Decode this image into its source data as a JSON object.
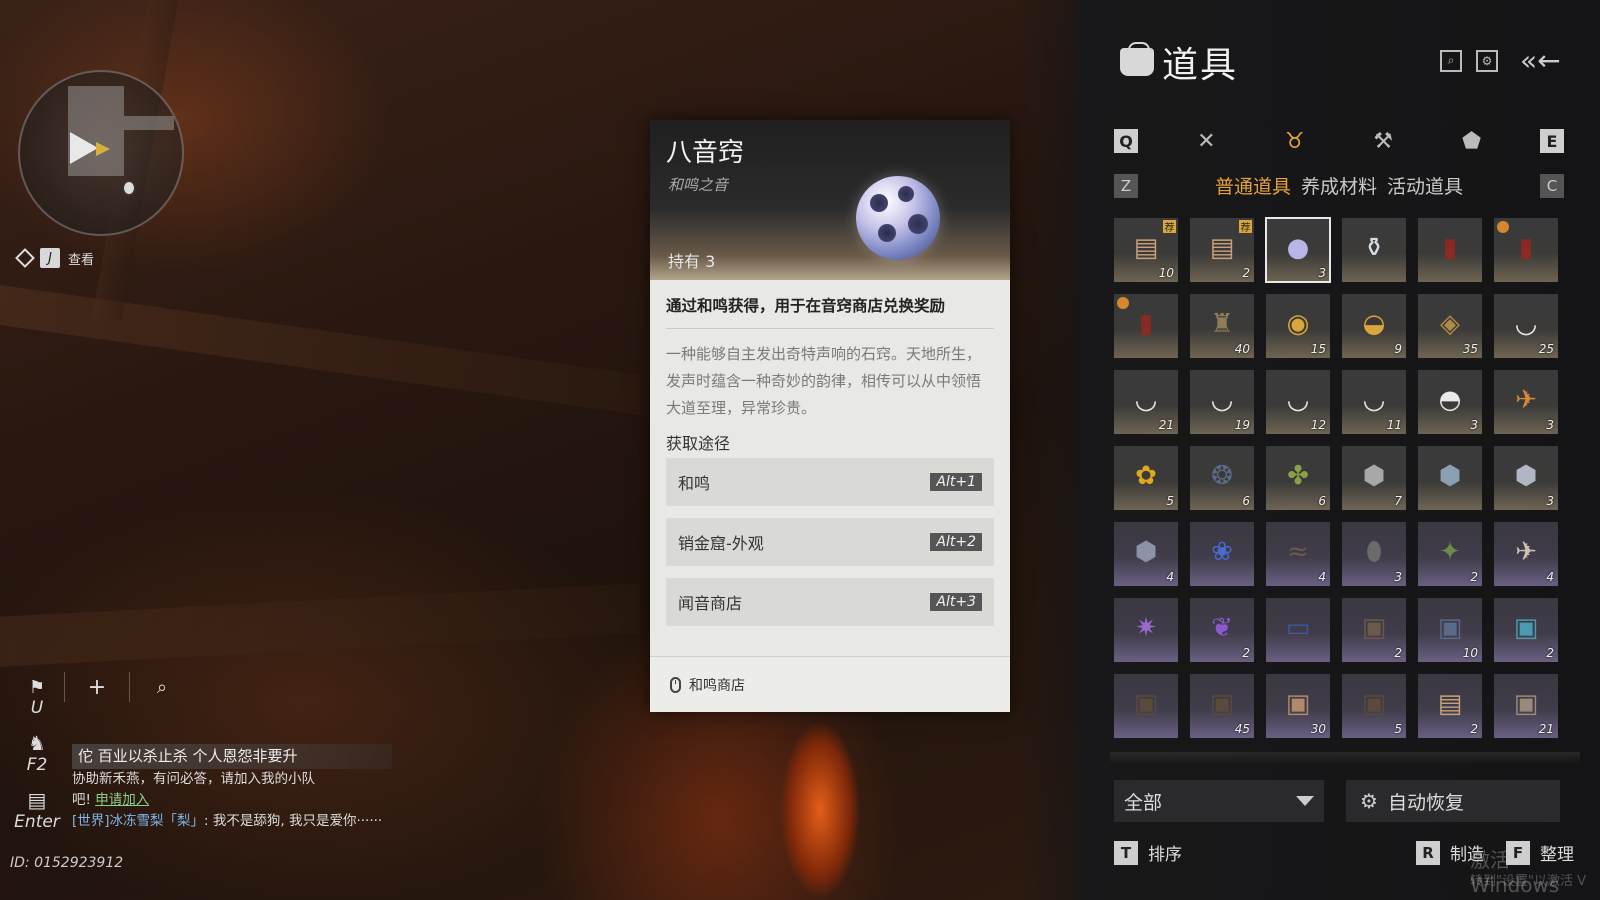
{
  "minimap": {
    "view_key": "J",
    "view_label": "查看"
  },
  "tools": {
    "flag_key": "U",
    "social_key": "F2",
    "chat_key": "Enter"
  },
  "chat": {
    "banner": "佗 百业以杀止杀 个人恩怨非要升",
    "line1": "协助新禾燕，有问必答，请加入我的小队",
    "line2_prefix": "吧! ",
    "line2_link": "申请加入",
    "line3_channel": "[世界]",
    "line3_name": "冰冻雪梨「梨」",
    "line3_text": ": 我不是舔狗, 我只是爱你······"
  },
  "user_id": "ID: 0152923912",
  "tooltip": {
    "title": "八音窍",
    "subtitle": "和鸣之音",
    "owned": "持有 3",
    "lead": "通过和鸣获得，用于在音窍商店兑换奖励",
    "desc": "一种能够自主发出奇特声响的石窍。天地所生，发声时蕴含一种奇妙的韵律，相传可以从中领悟大道至理，异常珍贵。",
    "section": "获取途径",
    "sources": [
      {
        "label": "和鸣",
        "key": "Alt+1"
      },
      {
        "label": "销金窟-外观",
        "key": "Alt+2"
      },
      {
        "label": "闻音商店",
        "key": "Alt+3"
      }
    ],
    "footer": "和鸣商店"
  },
  "inventory": {
    "title": "道具",
    "cat_left_key": "Q",
    "cat_right_key": "E",
    "sub_left_key": "Z",
    "sub_right_key": "C",
    "sub_tabs": [
      "普通道具",
      "养成材料",
      "活动道具"
    ],
    "active_sub_tab": 0,
    "tag_glyph": "荐",
    "items": [
      {
        "count": "10",
        "icon": "crate-icon",
        "glyph": "▤",
        "color": "#c8a27a",
        "tag": true
      },
      {
        "count": "2",
        "icon": "crate-icon",
        "glyph": "▤",
        "color": "#c8a27a",
        "tag": true
      },
      {
        "count": "3",
        "icon": "orb-icon",
        "glyph": "●",
        "color": "#b7b6e6",
        "sel": true
      },
      {
        "count": "",
        "icon": "vase-icon",
        "glyph": "⚱",
        "color": "#d8dce6"
      },
      {
        "count": "",
        "icon": "red-book-icon",
        "glyph": "▮",
        "color": "#8a2a22"
      },
      {
        "count": "",
        "icon": "red-book-icon",
        "glyph": "▮",
        "color": "#8a2a22",
        "clock": true
      },
      {
        "count": "",
        "icon": "red-book-icon",
        "glyph": "▮",
        "color": "#8a2a22",
        "clock": true
      },
      {
        "count": "40",
        "icon": "bronze-vessel-icon",
        "glyph": "♜",
        "color": "#8f7c5a"
      },
      {
        "count": "15",
        "icon": "gold-ring-icon",
        "glyph": "◉",
        "color": "#d9a73b"
      },
      {
        "count": "9",
        "icon": "gold-ingot-icon",
        "glyph": "◒",
        "color": "#d9a73b"
      },
      {
        "count": "35",
        "icon": "coin-icon",
        "glyph": "◈",
        "color": "#b08a48"
      },
      {
        "count": "25",
        "icon": "bowl-icon",
        "glyph": "◡",
        "color": "#eaeaea"
      },
      {
        "count": "21",
        "icon": "bowl-icon",
        "glyph": "◡",
        "color": "#eaeaea"
      },
      {
        "count": "19",
        "icon": "bowl-icon",
        "glyph": "◡",
        "color": "#eaeaea"
      },
      {
        "count": "12",
        "icon": "bowl-icon",
        "glyph": "◡",
        "color": "#eaeaea"
      },
      {
        "count": "11",
        "icon": "bowl-icon",
        "glyph": "◡",
        "color": "#eaeaea"
      },
      {
        "count": "3",
        "icon": "lidded-bowl-icon",
        "glyph": "◓",
        "color": "#eaeaea"
      },
      {
        "count": "3",
        "icon": "bird-icon",
        "glyph": "✈",
        "color": "#d28a3a"
      },
      {
        "count": "5",
        "icon": "flower-icon",
        "glyph": "✿",
        "color": "#e0a81e"
      },
      {
        "count": "6",
        "icon": "beetle-icon",
        "glyph": "❂",
        "color": "#5a6a8a"
      },
      {
        "count": "6",
        "icon": "bug-icon",
        "glyph": "✤",
        "color": "#8aa04a"
      },
      {
        "count": "7",
        "icon": "stone-icon",
        "glyph": "⬢",
        "color": "#a8a8a8"
      },
      {
        "count": "",
        "icon": "stone-icon",
        "glyph": "⬢",
        "color": "#8aa0b0"
      },
      {
        "count": "3",
        "icon": "stone-icon",
        "glyph": "⬢",
        "color": "#b0b6c6"
      },
      {
        "count": "4",
        "icon": "stone-icon",
        "glyph": "⬢",
        "color": "#8a94a6",
        "purple": true
      },
      {
        "count": "",
        "icon": "blue-flower-icon",
        "glyph": "❀",
        "color": "#4a6ad0",
        "purple": true
      },
      {
        "count": "4",
        "icon": "rat-icon",
        "glyph": "≈",
        "color": "#6a5a4a",
        "purple": true
      },
      {
        "count": "3",
        "icon": "egg-icon",
        "glyph": "⬮",
        "color": "#6a6a6a",
        "purple": true
      },
      {
        "count": "2",
        "icon": "cricket-icon",
        "glyph": "✦",
        "color": "#6a8a4a",
        "purple": true
      },
      {
        "count": "4",
        "icon": "bird-icon",
        "glyph": "✈",
        "color": "#d0c0b0",
        "purple": true
      },
      {
        "count": "",
        "icon": "purple-creature-icon",
        "glyph": "✷",
        "color": "#9a6ad0",
        "purple": true
      },
      {
        "count": "2",
        "icon": "purple-plant-icon",
        "glyph": "❦",
        "color": "#8a5ad0",
        "purple": true
      },
      {
        "count": "",
        "icon": "card-icon",
        "glyph": "▭",
        "color": "#3a5aa0",
        "purple": true
      },
      {
        "count": "2",
        "icon": "chest-icon",
        "glyph": "▣",
        "color": "#6a5a4a",
        "purple": true
      },
      {
        "count": "10",
        "icon": "chest-icon",
        "glyph": "▣",
        "color": "#5a6a8a",
        "purple": true
      },
      {
        "count": "2",
        "icon": "chest-icon",
        "glyph": "▣",
        "color": "#4a9ab0",
        "purple": true
      },
      {
        "count": "",
        "icon": "chest-icon",
        "glyph": "▣",
        "color": "#5a4a3a",
        "purple": true
      },
      {
        "count": "45",
        "icon": "chest-icon",
        "glyph": "▣",
        "color": "#5a4a3a",
        "purple": true
      },
      {
        "count": "30",
        "icon": "chest-icon",
        "glyph": "▣",
        "color": "#b08a6a",
        "purple": true
      },
      {
        "count": "5",
        "icon": "chest-icon",
        "glyph": "▣",
        "color": "#5a4a3a",
        "purple": true
      },
      {
        "count": "2",
        "icon": "crate-icon",
        "glyph": "▤",
        "color": "#c8a27a",
        "purple": true
      },
      {
        "count": "21",
        "icon": "chest-icon",
        "glyph": "▣",
        "color": "#9a8a7a",
        "purple": true
      }
    ],
    "filter_label": "全部",
    "auto_label": "自动恢复",
    "sort_key": "T",
    "sort_label": "排序",
    "craft_key": "R",
    "craft_label": "制造",
    "tidy_key": "F",
    "tidy_label": "整理"
  },
  "watermark": {
    "line1": "激活 Windows",
    "line2": "转到\"设置\"以激活 V"
  }
}
